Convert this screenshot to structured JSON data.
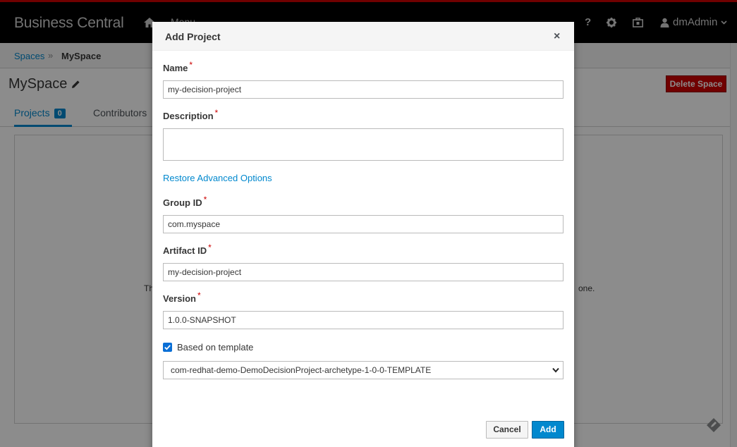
{
  "app": {
    "brand": "Business Central",
    "menu_label": "Menu",
    "help_label": "?",
    "user_name": "dmAdmin"
  },
  "breadcrumb": {
    "spaces": "Spaces",
    "separator": "»",
    "current": "MySpace"
  },
  "page": {
    "title": "MySpace",
    "delete_button": "Delete Space",
    "tabs": [
      {
        "label": "Projects",
        "count": "0"
      },
      {
        "label": "Contributors"
      }
    ],
    "empty_left": "Th",
    "empty_right": "one."
  },
  "modal": {
    "title": "Add Project",
    "close": "×",
    "required_mark": "*",
    "fields": {
      "name": {
        "label": "Name",
        "value": "my-decision-project"
      },
      "description": {
        "label": "Description",
        "value": ""
      },
      "group_id": {
        "label": "Group ID",
        "value": "com.myspace"
      },
      "artifact_id": {
        "label": "Artifact ID",
        "value": "my-decision-project"
      },
      "version": {
        "label": "Version",
        "value": "1.0.0-SNAPSHOT"
      }
    },
    "restore_link": "Restore Advanced Options",
    "template_checkbox": {
      "label": "Based on template",
      "checked": true
    },
    "template_select": {
      "selected": "com-redhat-demo-DemoDecisionProject-archetype-1-0-0-TEMPLATE"
    },
    "cancel_button": "Cancel",
    "add_button": "Add"
  },
  "colors": {
    "accent": "#0088ce",
    "danger": "#cc0000",
    "annotation_arrow": "#e02020"
  }
}
